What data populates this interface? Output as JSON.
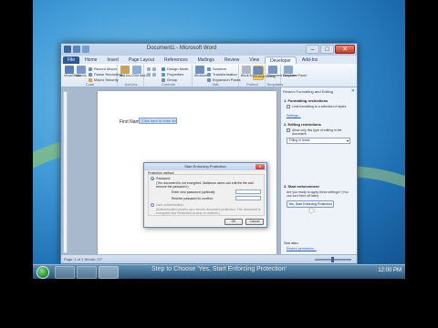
{
  "window": {
    "title": "Document1 - Microsoft Word",
    "controls": {
      "minimize": "–",
      "maximize": "□",
      "close": "✕"
    }
  },
  "ribbon": {
    "tabs": [
      {
        "label": "File"
      },
      {
        "label": "Home"
      },
      {
        "label": "Insert"
      },
      {
        "label": "Page Layout"
      },
      {
        "label": "References"
      },
      {
        "label": "Mailings"
      },
      {
        "label": "Review"
      },
      {
        "label": "View"
      },
      {
        "label": "Developer"
      },
      {
        "label": "Add-Ins"
      }
    ],
    "groups": {
      "code": {
        "label": "Code",
        "visual_basic": "Visual Basic",
        "macros": "Macros",
        "record_macro": "Record Macro",
        "pause_recording": "Pause Recording",
        "macro_security": "Macro Security"
      },
      "addins": {
        "label": "Add-Ins",
        "addins": "Add-Ins",
        "com_addins": "COM Add-Ins"
      },
      "controls": {
        "label": "Controls",
        "design_mode": "Design Mode",
        "properties": "Properties",
        "group": "Group"
      },
      "xml": {
        "label": "XML",
        "structure": "Structure",
        "schema": "Schema",
        "transformation": "Transformation",
        "expansion_packs": "Expansion Packs"
      },
      "protect": {
        "label": "Protect",
        "block_authors": "Block Authors",
        "restrict_editing": "Restrict Editing"
      },
      "templates": {
        "label": "Templates",
        "document_template": "Document Template"
      },
      "panel": {
        "document_panel": "Document Panel"
      }
    }
  },
  "document": {
    "field_label": "First Name:",
    "content_control_placeholder": "Click here to enter text."
  },
  "statusbar": {
    "left": "Page: 1 of 1   Words: 2/7"
  },
  "pane": {
    "title": "Restrict Formatting and Editing",
    "close": "✕",
    "step1_title": "1. Formatting restrictions",
    "step1_check": "Limit formatting to a selection of styles",
    "step1_link": "Settings...",
    "step2_title": "2. Editing restrictions",
    "step2_check": "Allow only this type of editing in the document:",
    "step2_dropdown": "Filling in forms",
    "step3_title": "3. Start enforcement",
    "step3_text": "Are you ready to apply these settings? (You can turn them off later)",
    "step3_button": "Yes, Start Enforcing Protection",
    "see_also": "See also",
    "restrict_link": "Restrict permission..."
  },
  "dialog": {
    "title": "Start Enforcing Protection",
    "close": "✕",
    "section_label": "Protection method",
    "password_option": "Password",
    "password_desc": "(The document is not encrypted. Malicious users can edit the file and remove the password.)",
    "enter_password": "Enter new password (optional):",
    "reenter_password": "Reenter password to confirm:",
    "user_auth_option": "User authentication",
    "user_auth_desc": "(Authenticated owners can remove document protection. The document is encrypted and Restricted Access is enabled.)",
    "ok": "OK",
    "cancel": "Cancel"
  },
  "caption": "Step to Choose 'Yes, Start Enforcing Protection'",
  "taskbar": {
    "clock": "12:00 PM"
  }
}
